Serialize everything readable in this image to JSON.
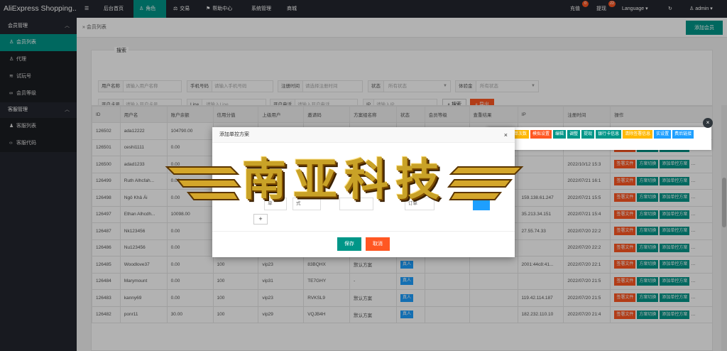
{
  "app": {
    "brand": "AliExpress Shopping..."
  },
  "topnav": [
    {
      "label": "后台首页",
      "icon": "home-icon"
    },
    {
      "label": "角色",
      "icon": "user-icon"
    },
    {
      "label": "交易",
      "icon": "balance-icon"
    },
    {
      "label": "帮助中心",
      "icon": "flag-icon"
    },
    {
      "label": "系统管理",
      "icon": ""
    },
    {
      "label": "商城",
      "icon": ""
    }
  ],
  "topright": {
    "recharge": "充值",
    "recharge_count": "0",
    "withdraw": "提现",
    "withdraw_count": "22",
    "language": "Language",
    "user": "admin"
  },
  "sidebar": {
    "group1": "会员管理",
    "items1": [
      "会员列表",
      "代理",
      "试玩号",
      "会员等级"
    ],
    "group2": "客服管理",
    "items2": [
      "客服列表",
      "客服代码"
    ]
  },
  "breadcrumb": "会员列表",
  "add_button": "添加会员",
  "search": {
    "legend": "搜索",
    "fields": [
      {
        "label": "用户名称",
        "placeholder": "请输入用户名称"
      },
      {
        "label": "手机号码",
        "placeholder": "请输入手机号码"
      },
      {
        "label": "注册时间",
        "placeholder": "请选择注册时间"
      },
      {
        "label": "状态",
        "placeholder": "所有状态"
      },
      {
        "label": "体验金",
        "placeholder": "所有状态"
      },
      {
        "label": "开户卡号",
        "placeholder": "请输入开户卡号"
      },
      {
        "label": "Line",
        "placeholder": "请输入Line"
      },
      {
        "label": "开户电话",
        "placeholder": "请输入开户电话"
      },
      {
        "label": "IP",
        "placeholder": "请输入IP"
      }
    ],
    "search_btn": "搜索",
    "export_btn": "导出"
  },
  "table": {
    "headers": [
      "ID",
      "用户名",
      "账户余额",
      "信用分值",
      "上级用户",
      "邀请码",
      "方案组名称",
      "状态",
      "会员等级",
      "查重结果",
      "IP",
      "注册时间",
      "操作"
    ],
    "rows": [
      [
        "126502",
        "ada12222",
        "104790.00",
        "",
        "",
        "",
        "",
        "",
        "",
        "",
        "",
        "",
        ""
      ],
      [
        "126501",
        "ceshi1111",
        "0.00",
        "",
        "",
        "",
        "",
        "",
        "",
        "",
        "154.254.20.54",
        "2021/10/19 15:5",
        ""
      ],
      [
        "126500",
        "adad1233",
        "0.00",
        "",
        "",
        "",
        "",
        "",
        "",
        "",
        "",
        "2022/10/12 15:3",
        ""
      ],
      [
        "126499",
        "Ruth Alhcfah...",
        "0.00",
        "",
        "",
        "",
        "",
        "",
        "",
        "",
        "",
        "2022/07/21 16:1",
        ""
      ],
      [
        "126498",
        "Ngô Khả Ái",
        "0.00",
        "",
        "",
        "",
        "",
        "",
        "",
        "",
        "159.138.61.247",
        "2022/07/21 15:5",
        ""
      ],
      [
        "126497",
        "Ethan Alhcdh...",
        "10098.00",
        "",
        "",
        "",
        "",
        "",
        "",
        "",
        "35.213.34.151",
        "2022/07/21 15:4",
        ""
      ],
      [
        "126487",
        "Nk123456",
        "0.00",
        "",
        "",
        "",
        "",
        "",
        "",
        "",
        "27.55.74.33",
        "2022/07/20 22:2",
        ""
      ],
      [
        "126486",
        "Nu123456",
        "0.00",
        "100",
        "mvp31",
        "792AG8",
        "-",
        "真人",
        "",
        "",
        "",
        "2022/07/20 22:2",
        ""
      ],
      [
        "126485",
        "Woodlove37",
        "0.00",
        "100",
        "vip23",
        "83BQHX",
        "默认方案",
        "真人",
        "",
        "",
        "2001:44c8:41...",
        "2022/07/20 22:1",
        ""
      ],
      [
        "126484",
        "Marymount",
        "0.00",
        "100",
        "vip31",
        "TE7GHY",
        "-",
        "真人",
        "",
        "",
        "",
        "2022/07/20 21:5",
        ""
      ],
      [
        "126483",
        "kanny69",
        "0.00",
        "100",
        "vip23",
        "RVKSL9",
        "默认方案",
        "真人",
        "",
        "",
        "119.42.114.187",
        "2022/07/20 21:5",
        ""
      ],
      [
        "126482",
        "ponr11",
        "30.00",
        "100",
        "vip29",
        "VQJB4H",
        "默认方案",
        "真人",
        "",
        "",
        "182.232.110.10",
        "2022/07/20 21:4",
        ""
      ]
    ],
    "row_actions": [
      "签署文件",
      "方案切换",
      "添加单控方案"
    ]
  },
  "popup_actions": [
    "资",
    "首提抢单次数",
    "模拟设置",
    "编辑",
    "调整",
    "提现",
    "银行卡信息",
    "清除签署信息",
    "实设置",
    "费后链接",
    "信用分调整"
  ],
  "modal": {
    "title": "添加单控方案",
    "fields": [
      "单",
      "式",
      "",
      "订单",
      ""
    ],
    "plus": "+",
    "save": "保存",
    "cancel": "取消"
  },
  "watermark": "南亚科技"
}
